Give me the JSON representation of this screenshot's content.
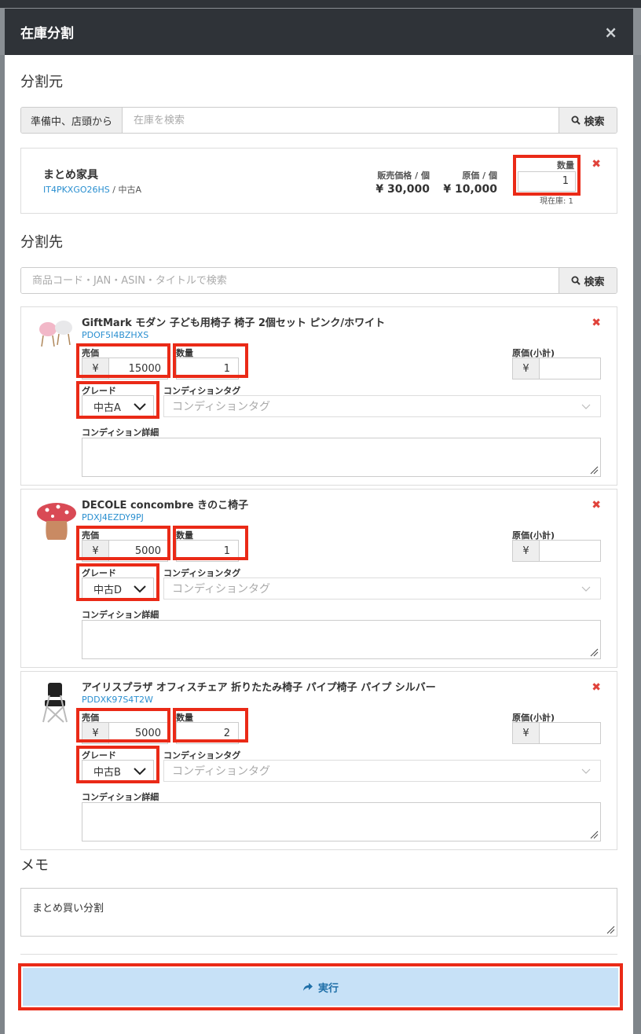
{
  "modal": {
    "title": "在庫分割",
    "close": "×"
  },
  "source": {
    "heading": "分割元",
    "search_addon": "準備中、店頭から",
    "search_placeholder": "在庫を検索",
    "search_button": "検索",
    "item": {
      "name": "まとめ家具",
      "code": "IT4PKXGO26HS",
      "grade": " / 中古A",
      "sale_price_label": "販売価格 / 個",
      "sale_price": "¥ 30,000",
      "cost_label": "原価 / 個",
      "cost": "¥ 10,000",
      "qty_label": "数量",
      "qty": "1",
      "stock_note": "現在庫: 1"
    }
  },
  "dest": {
    "heading": "分割先",
    "search_placeholder": "商品コード・JAN・ASIN・タイトルで検索",
    "search_button": "検索",
    "labels": {
      "price": "売価",
      "qty": "数量",
      "cost_subtotal": "原価(小計)",
      "grade": "グレード",
      "tag": "コンディションタグ",
      "tag_placeholder": "コンディションタグ",
      "detail": "コンディション詳細",
      "yen": "¥"
    },
    "items": [
      {
        "title": "GiftMark モダン 子ども用椅子 椅子 2個セット ピンク/ホワイト",
        "code": "PDOF5I4BZHXS",
        "price": "15000",
        "qty": "1",
        "grade": "中古A",
        "thumb": "kids-chairs-icon"
      },
      {
        "title": "DECOLE concombre きのこ椅子",
        "code": "PDXJ4EZDY9PJ",
        "price": "5000",
        "qty": "1",
        "grade": "中古D",
        "thumb": "mushroom-stool-icon"
      },
      {
        "title": "アイリスプラザ オフィスチェア 折りたたみ椅子 パイプ椅子 パイプ シルバー",
        "code": "PDDXK97S4T2W",
        "price": "5000",
        "qty": "2",
        "grade": "中古B",
        "thumb": "folding-chair-icon"
      }
    ]
  },
  "memo": {
    "heading": "メモ",
    "value": "まとめ買い分割"
  },
  "execute": {
    "label": "実行"
  },
  "colors": {
    "header": "#2f3338",
    "highlight": "#ea2a17",
    "link": "#2a8fd0",
    "execute_bg": "#c7e1f7"
  }
}
